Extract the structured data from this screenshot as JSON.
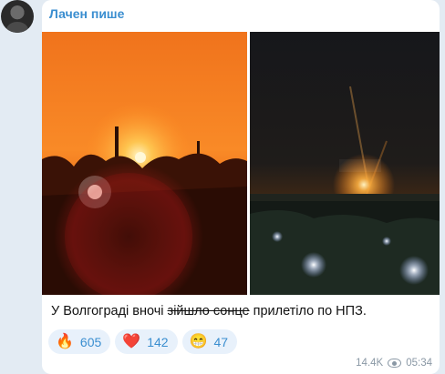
{
  "channel": {
    "author": "Лачен пише"
  },
  "post": {
    "caption_start": "У Волгограді вночі ",
    "caption_struck": "зійшло сонце",
    "caption_end": " прилетіло по НПЗ.",
    "photos": [
      "photo-sunset-refinery-fire",
      "photo-night-refinery-fire"
    ],
    "views": "14.4K",
    "time": "05:34"
  },
  "reactions": [
    {
      "icon": "fire-emoji",
      "emoji": "🔥",
      "count": "605"
    },
    {
      "icon": "heart-emoji",
      "emoji": "❤️",
      "count": "142"
    },
    {
      "icon": "grin-emoji",
      "emoji": "😁",
      "count": "47"
    }
  ],
  "colors": {
    "accent": "#3a8ed0",
    "reaction_bg": "#e8f1fb",
    "chat_bg": "#e3ebf3"
  }
}
